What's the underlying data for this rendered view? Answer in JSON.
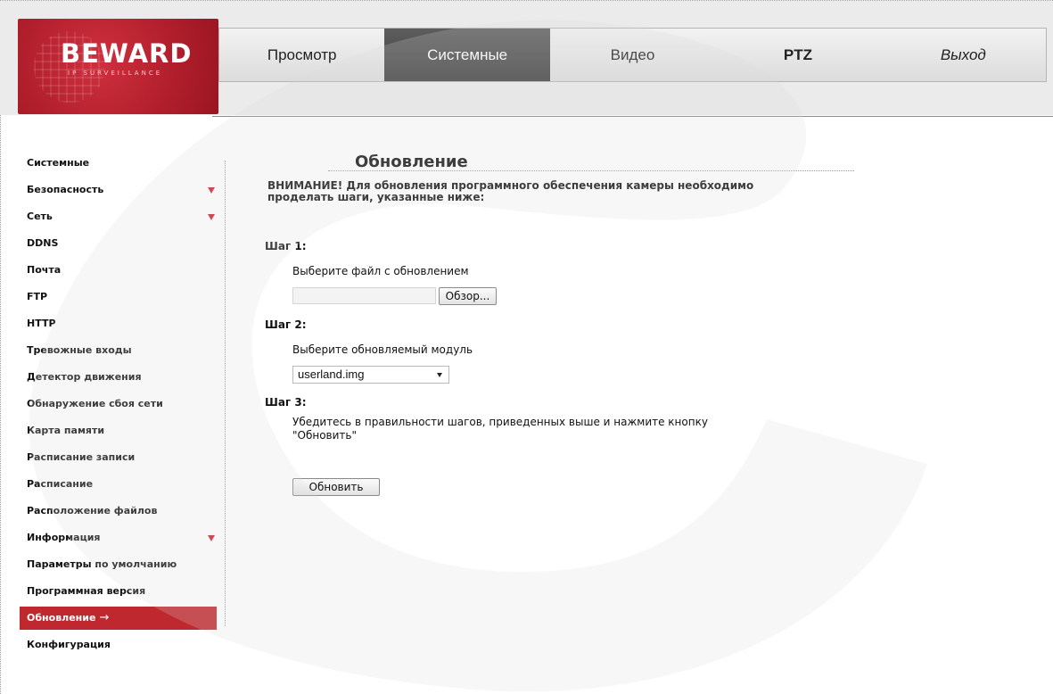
{
  "brand": {
    "name": "BEWARD",
    "tagline": "IP SURVEILLANCE"
  },
  "nav": {
    "tabs": [
      {
        "label": "Просмотр"
      },
      {
        "label": "Системные"
      },
      {
        "label": "Видео"
      },
      {
        "label": "PTZ"
      },
      {
        "label": "Выход"
      }
    ],
    "active": "Системные"
  },
  "sidebar": {
    "items": [
      {
        "label": "Системные",
        "expandable": false
      },
      {
        "label": "Безопасность",
        "expandable": true
      },
      {
        "label": "Сеть",
        "expandable": true
      },
      {
        "label": "DDNS",
        "expandable": false
      },
      {
        "label": "Почта",
        "expandable": false
      },
      {
        "label": "FTP",
        "expandable": false
      },
      {
        "label": "HTTP",
        "expandable": false
      },
      {
        "label": "Тревожные входы",
        "expandable": false
      },
      {
        "label": "Детектор движения",
        "expandable": false
      },
      {
        "label": "Обнаружение сбоя сети",
        "expandable": false
      },
      {
        "label": "Карта памяти",
        "expandable": false
      },
      {
        "label": "Расписание записи",
        "expandable": false
      },
      {
        "label": "Расписание",
        "expandable": false
      },
      {
        "label": "Расположение файлов",
        "expandable": false
      },
      {
        "label": "Информация",
        "expandable": true
      },
      {
        "label": "Параметры по умолчанию",
        "expandable": false
      },
      {
        "label": "Программная версия",
        "expandable": false
      },
      {
        "label": "Обновление",
        "expandable": false
      },
      {
        "label": "Конфигурация",
        "expandable": false
      }
    ],
    "active": "Обновление",
    "active_marker": "→"
  },
  "page": {
    "title": "Обновление",
    "warning": "ВНИМАНИЕ! Для обновления программного обеспечения камеры необходимо проделать шаги, указанные ниже:",
    "step1": {
      "label": "Шаг 1:",
      "text": "Выберите файл с обновлением",
      "file_value": "",
      "browse_label": "Обзор..."
    },
    "step2": {
      "label": "Шаг 2:",
      "text": "Выберите обновляемый модуль",
      "selected": "userland.img"
    },
    "step3": {
      "label": "Шаг 3:",
      "text": "Убедитесь в правильности шагов, приведенных выше и нажмите кнопку \"Обновить\""
    },
    "update_label": "Обновить"
  },
  "colors": {
    "accent": "#c0282f",
    "active_tab": "#4a4a4a",
    "header_bg": "#ebebeb"
  }
}
